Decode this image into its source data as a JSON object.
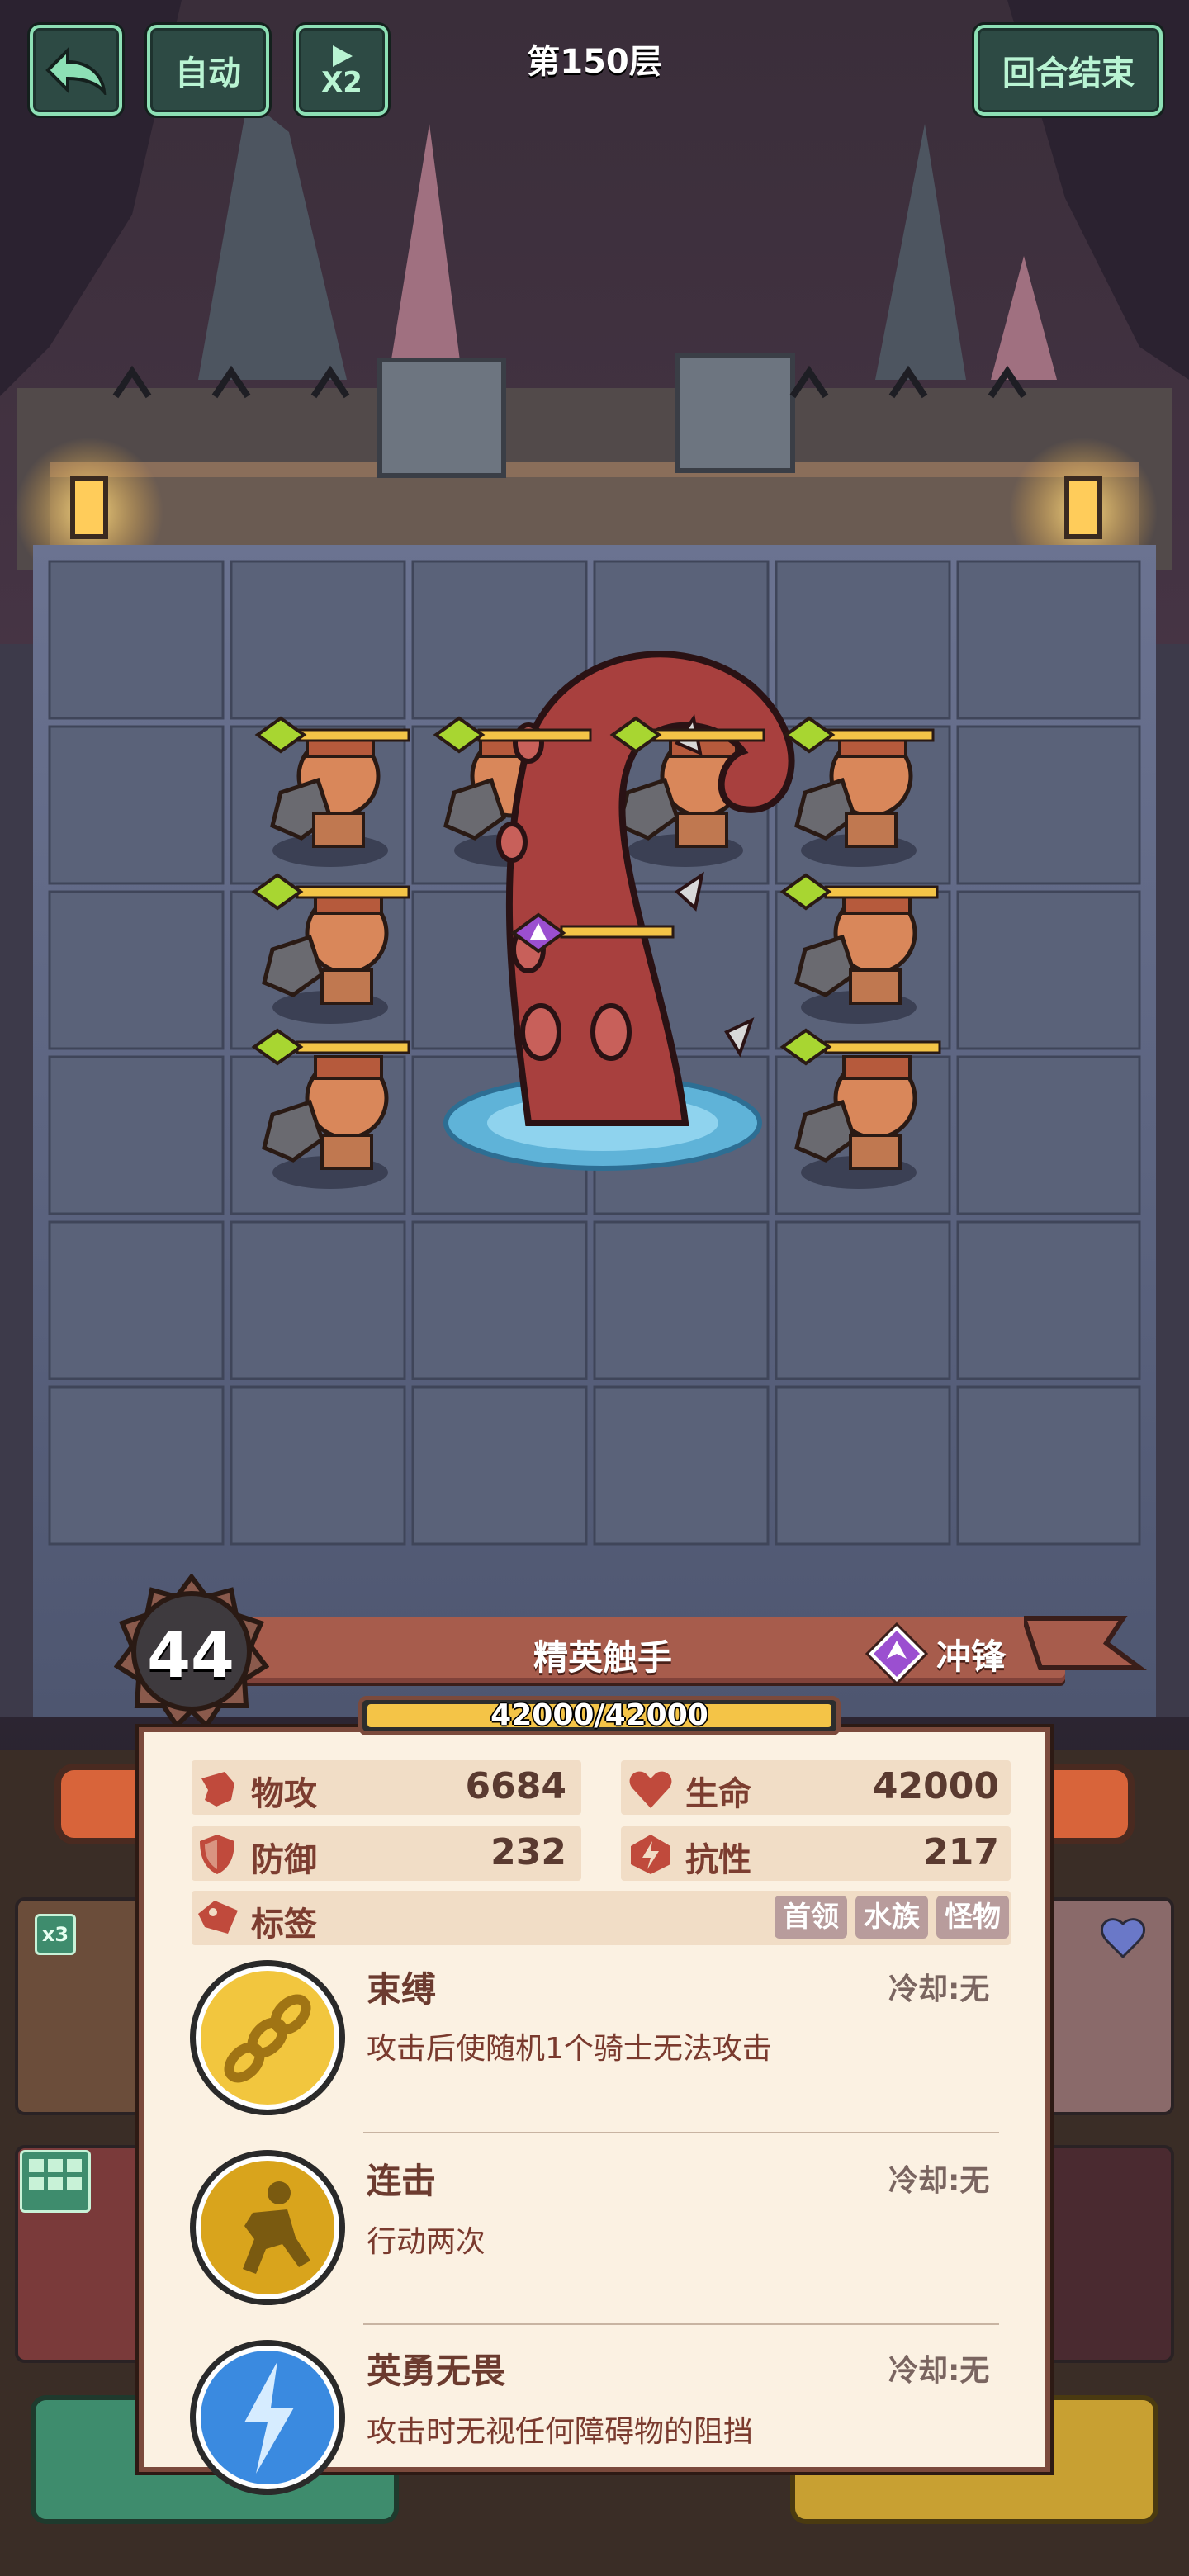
{
  "hud": {
    "auto_label": "自动",
    "speed_label": "X2",
    "floor_title": "第150层",
    "end_turn_label": "回合结束"
  },
  "boss": {
    "level": "44",
    "name": "精英触手",
    "trait": "冲锋",
    "hp_text": "42000/42000",
    "hp_fraction": 1.0,
    "stats": {
      "attack_label": "物攻",
      "attack_value": "6684",
      "life_label": "生命",
      "life_value": "42000",
      "defense_label": "防御",
      "defense_value": "232",
      "resist_label": "抗性",
      "resist_value": "217",
      "tags_label": "标签"
    },
    "tags": [
      "首领",
      "水族",
      "怪物"
    ],
    "skills": [
      {
        "name": "束缚",
        "cooldown": "冷却:无",
        "desc": "攻击后使随机1个骑士无法攻击",
        "icon": "chain-icon"
      },
      {
        "name": "连击",
        "cooldown": "冷却:无",
        "desc": "行动两次",
        "icon": "dash-figure-icon"
      },
      {
        "name": "英勇无畏",
        "cooldown": "冷却:无",
        "desc": "攻击时无视任何障碍物的阻挡",
        "icon": "lightning-icon"
      }
    ]
  },
  "side": {
    "badge_x3": "x3"
  },
  "colors": {
    "hud_green": "#8de0b5",
    "hp_yellow": "#f4c447",
    "banner": "#a75c4c",
    "tag_bg": "#b89c9c",
    "target_marker": "#a8d631",
    "boss_marker": "#9b4fd0"
  }
}
